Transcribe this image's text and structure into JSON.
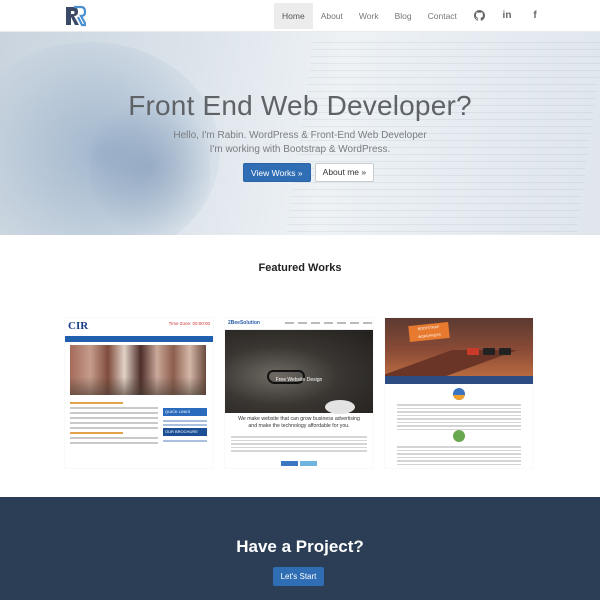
{
  "nav": {
    "items": [
      {
        "label": "Home",
        "active": true
      },
      {
        "label": "About",
        "active": false
      },
      {
        "label": "Work",
        "active": false
      },
      {
        "label": "Blog",
        "active": false
      },
      {
        "label": "Contact",
        "active": false
      }
    ],
    "social_icons": [
      "github-icon",
      "linkedin-icon",
      "facebook-icon"
    ],
    "linkedin_glyph": "in",
    "facebook_glyph": "f"
  },
  "hero": {
    "title": "Front End Web Developer?",
    "subtitle_line1": "Hello, I'm Rabin. WordPress & Front-End Web Developer",
    "subtitle_line2": "I'm working with Bootstrap & WordPress.",
    "primary_button": "View Works »",
    "secondary_button": "About me »"
  },
  "featured": {
    "title": "Featured Works",
    "cards": [
      {
        "logo": "CIR",
        "time_label": "Time Zone: 00:00:00",
        "quick_links": "QUICK LINKS",
        "brochure": "OUR BROCHURE"
      },
      {
        "logo": "2BeeSolution",
        "hero_text": "Free Website Design",
        "body_line1": "We make website that can grow business advertising",
        "body_line2": "and make the technology affordable for you."
      },
      {
        "badge": "BOOTSTRAP WORDPRESS"
      }
    ]
  },
  "cta": {
    "title": "Have a Project?",
    "button": "Let's Start"
  },
  "colors": {
    "accent": "#2f6db5",
    "cta_background": "#2b3e55"
  }
}
